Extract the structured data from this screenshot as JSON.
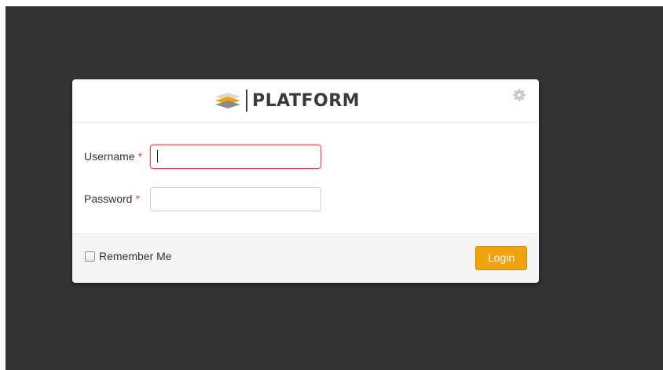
{
  "app": {
    "logo_text": "PLATFORM"
  },
  "form": {
    "username_label": "Username",
    "password_label": "Password",
    "required_marker": "*",
    "username_value": "",
    "password_value": "",
    "remember_label": "Remember Me",
    "remember_checked": false,
    "login_label": "Login"
  },
  "icons": {
    "logo": "layered-platform-logo-icon",
    "settings": "gear-icon"
  },
  "colors": {
    "backdrop": "#333333",
    "accent": "#f0a30a",
    "required": "#e04a3b",
    "error_border": "#d9534f"
  }
}
